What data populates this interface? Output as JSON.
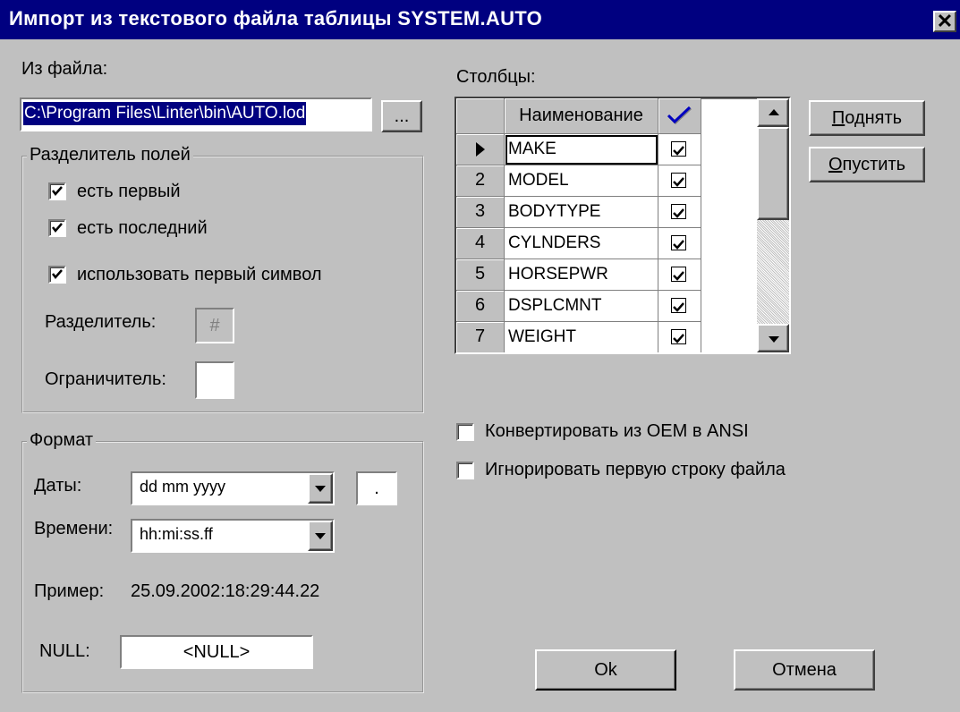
{
  "window": {
    "title": "Импорт из текстового файла таблицы SYSTEM.AUTO",
    "close_glyph": "✕"
  },
  "file": {
    "label": "Из файла:",
    "path": "C:\\Program Files\\Linter\\bin\\AUTO.lod",
    "browse_label": "..."
  },
  "separator_group": {
    "title": "Разделитель полей",
    "has_first": {
      "label": "есть первый",
      "checked": true
    },
    "has_last": {
      "label": "есть последний",
      "checked": true
    },
    "use_first_char": {
      "label": "использовать первый символ",
      "checked": true
    },
    "separator_label": "Разделитель:",
    "separator_value": "#",
    "delimiter_label": "Ограничитель:",
    "delimiter_value": ""
  },
  "format_group": {
    "title": "Формат",
    "dates_label": "Даты:",
    "dates_value": "dd mm yyyy",
    "date_sep_value": ".",
    "time_label": "Времени:",
    "time_value": "hh:mi:ss.ff",
    "example_label": "Пример:",
    "example_value": "25.09.2002:18:29:44.22",
    "null_label": "NULL:",
    "null_value": "<NULL>"
  },
  "columns": {
    "label": "Столбцы:",
    "header_name": "Наименование",
    "header_check_icon": "checkmark-icon",
    "rows": [
      {
        "num": "",
        "name": "MAKE",
        "checked": true,
        "current": true
      },
      {
        "num": "2",
        "name": "MODEL",
        "checked": true
      },
      {
        "num": "3",
        "name": "BODYTYPE",
        "checked": true
      },
      {
        "num": "4",
        "name": "CYLNDERS",
        "checked": true
      },
      {
        "num": "5",
        "name": "HORSEPWR",
        "checked": true
      },
      {
        "num": "6",
        "name": "DSPLCMNT",
        "checked": true
      },
      {
        "num": "7",
        "name": "WEIGHT",
        "checked": true
      }
    ]
  },
  "buttons": {
    "up_first": "П",
    "up_rest": "однять",
    "down_first": "О",
    "down_rest": "пустить",
    "ok": "Ok",
    "cancel": "Отмена"
  },
  "options": {
    "convert_oem": {
      "label": "Конвертировать из OEM в ANSI",
      "checked": false
    },
    "ignore_first_line": {
      "label": "Игнорировать первую строку файла",
      "checked": false
    }
  }
}
